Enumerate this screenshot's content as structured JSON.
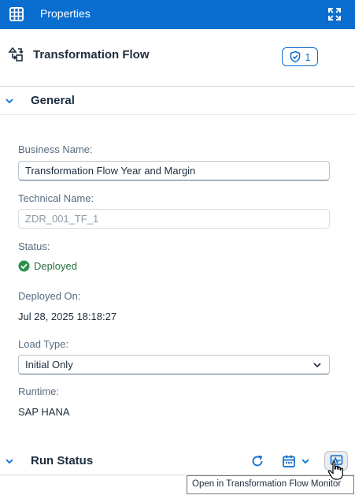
{
  "topbar": {
    "title": "Properties",
    "icons": [
      "grid-icon",
      "expand-icon"
    ]
  },
  "header": {
    "title": "Transformation Flow",
    "badge_count": "1",
    "icons": [
      "transformation-flow-icon",
      "shield-check-icon"
    ]
  },
  "general": {
    "title": "General",
    "business_name_label": "Business Name:",
    "business_name_value": "Transformation Flow Year and Margin",
    "technical_name_label": "Technical Name:",
    "technical_name_value": "ZDR_001_TF_1",
    "status_label": "Status:",
    "status_value": "Deployed",
    "deployed_on_label": "Deployed On:",
    "deployed_on_value": "Jul 28, 2025 18:18:27",
    "load_type_label": "Load Type:",
    "load_type_value": "Initial Only",
    "runtime_label": "Runtime:",
    "runtime_value": "SAP HANA"
  },
  "run_status": {
    "title": "Run Status",
    "icons": [
      "refresh-icon",
      "calendar-icon",
      "monitor-icon"
    ]
  },
  "tooltip": {
    "text": "Open in Transformation Flow Monitor"
  },
  "colors": {
    "brand": "#0a6ed1",
    "success": "#256f3a",
    "text": "#1d2d3e",
    "label": "#556b82"
  }
}
